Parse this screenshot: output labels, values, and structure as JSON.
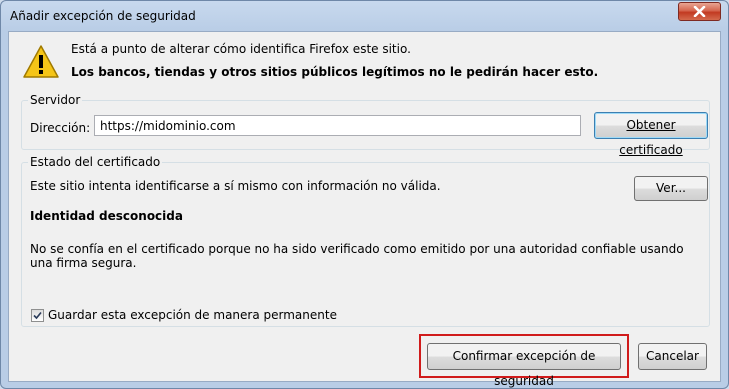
{
  "window": {
    "title": "Añadir excepción de seguridad"
  },
  "message": {
    "line1": "Está a punto de alterar cómo identifica Firefox este sitio.",
    "line2": "Los bancos, tiendas y otros sitios públicos legítimos no le pedirán hacer esto."
  },
  "server": {
    "legend": "Servidor",
    "address_label": "Dirección:",
    "address_value": "https://midominio.com",
    "get_cert_button": "Obtener certificado"
  },
  "cert_status": {
    "legend": "Estado del certificado",
    "text": "Este sitio intenta identificarse a sí mismo con información no válida.",
    "view_button": "Ver...",
    "identity_title": "Identidad desconocida",
    "reason": "No se confía en el certificado porque no ha sido verificado como emitido por una autoridad confiable usando una firma segura."
  },
  "permanent": {
    "label": "Guardar esta excepción de manera permanente",
    "checked": true
  },
  "buttons": {
    "confirm": "Confirmar excepción de seguridad",
    "cancel": "Cancelar"
  },
  "icons": {
    "warning": "warning-icon",
    "close": "close-icon",
    "check": "check-icon"
  },
  "colors": {
    "highlight": "#d01b1b",
    "close_button": "#c23a22",
    "warning": "#f5c518"
  }
}
